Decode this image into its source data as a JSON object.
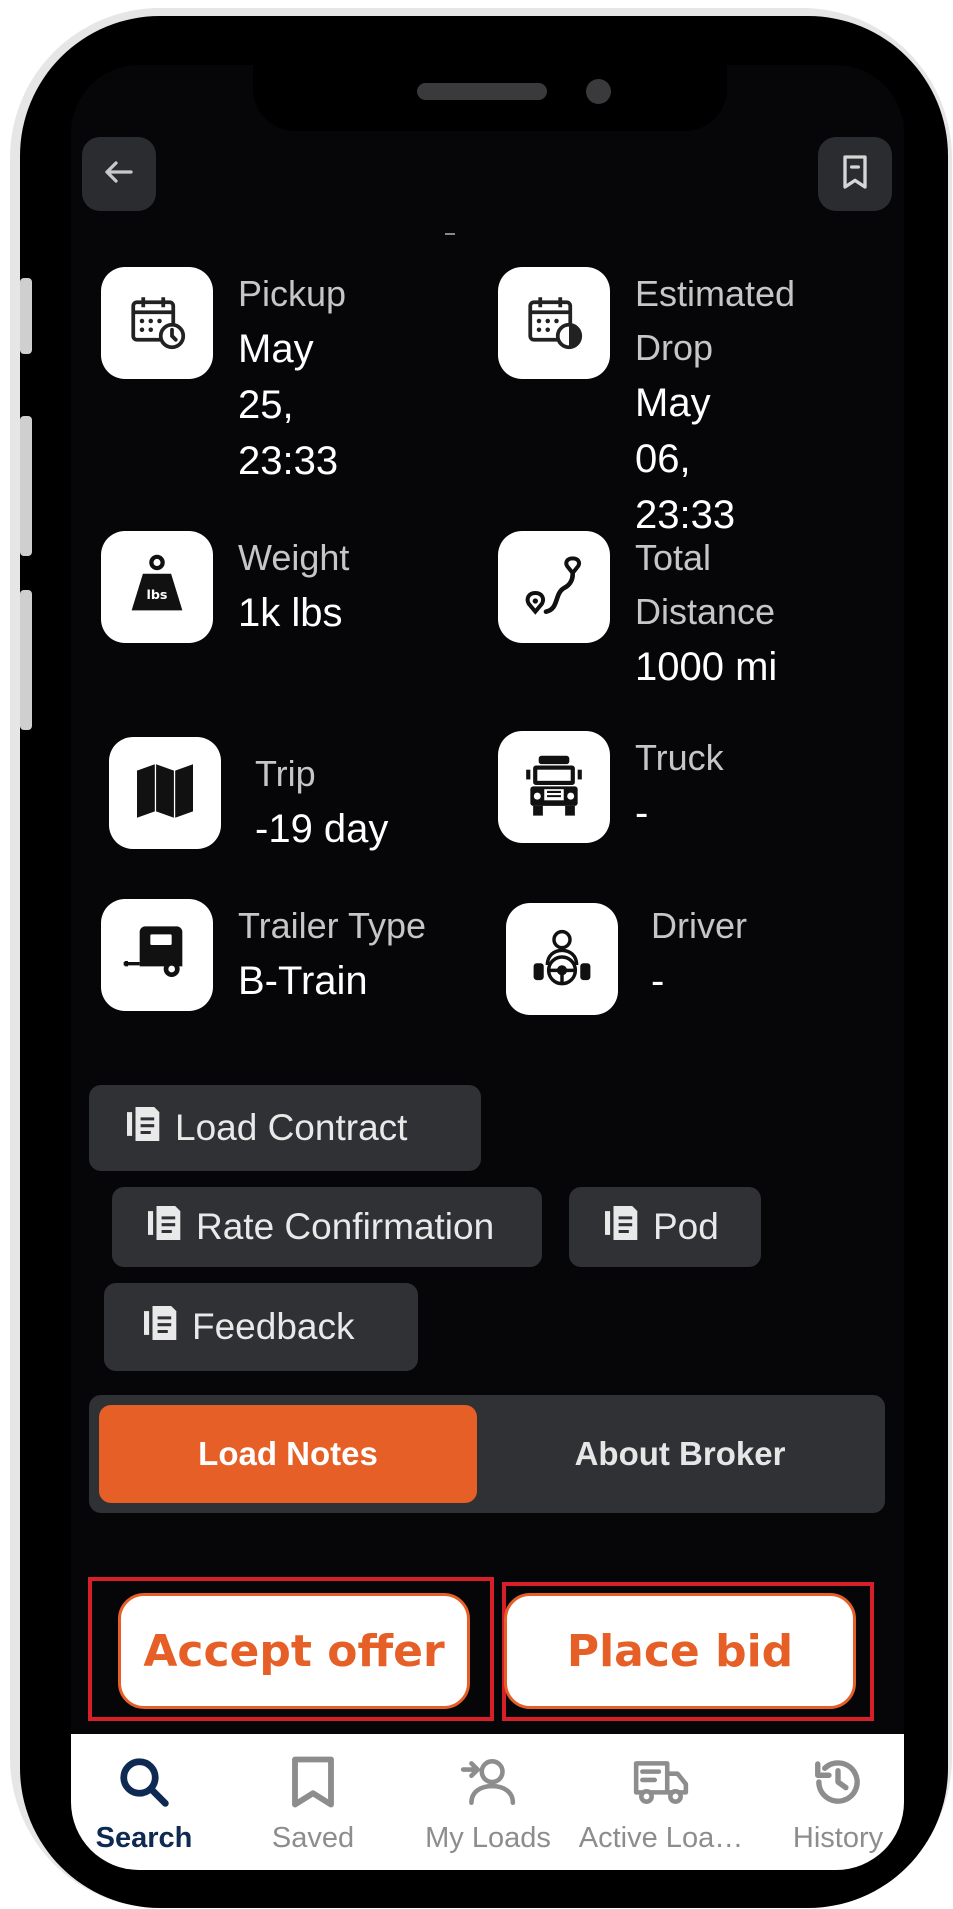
{
  "header": {
    "back_icon": "arrow-left-icon",
    "bookmark_icon": "bookmark-icon"
  },
  "details": {
    "pickup": {
      "label": "Pickup",
      "value": "May 25,\n23:33",
      "icon": "calendar-clock-icon"
    },
    "drop": {
      "label": "Estimated\nDrop",
      "value": "May 06,\n23:33",
      "icon": "calendar-icon"
    },
    "weight": {
      "label": "Weight",
      "value": "1k lbs",
      "icon": "weight-icon"
    },
    "distance": {
      "label": "Total\nDistance",
      "value": "1000 mi",
      "icon": "route-icon"
    },
    "trip": {
      "label": "Trip",
      "value": "-19 day",
      "icon": "map-icon"
    },
    "truck": {
      "label": "Truck",
      "value": "-",
      "icon": "truck-icon"
    },
    "trailer": {
      "label": "Trailer Type",
      "value": "B-Train",
      "icon": "trailer-icon"
    },
    "driver": {
      "label": "Driver",
      "value": "-",
      "icon": "driver-icon"
    }
  },
  "documents": {
    "load_contract": "Load Contract",
    "rate_confirmation": "Rate Confirmation",
    "pod": "Pod",
    "feedback": "Feedback"
  },
  "tabs": {
    "load_notes": "Load Notes",
    "about_broker": "About Broker",
    "active": "Load Notes"
  },
  "actions": {
    "accept_offer": "Accept offer",
    "place_bid": "Place bid"
  },
  "nav": {
    "items": [
      {
        "label": "Search",
        "icon": "search-icon",
        "active": true
      },
      {
        "label": "Saved",
        "icon": "bookmark-icon",
        "active": false
      },
      {
        "label": "My Loads",
        "icon": "add-user-icon",
        "active": false
      },
      {
        "label": "Active Loa…",
        "icon": "truck-icon",
        "active": false
      },
      {
        "label": "History",
        "icon": "history-icon",
        "active": false
      }
    ]
  },
  "colors": {
    "accent": "#e55f27",
    "screen_bg": "#060608",
    "chip_bg": "#2f3134",
    "nav_active": "#0e2a52",
    "highlight_box": "#d71f2a"
  }
}
